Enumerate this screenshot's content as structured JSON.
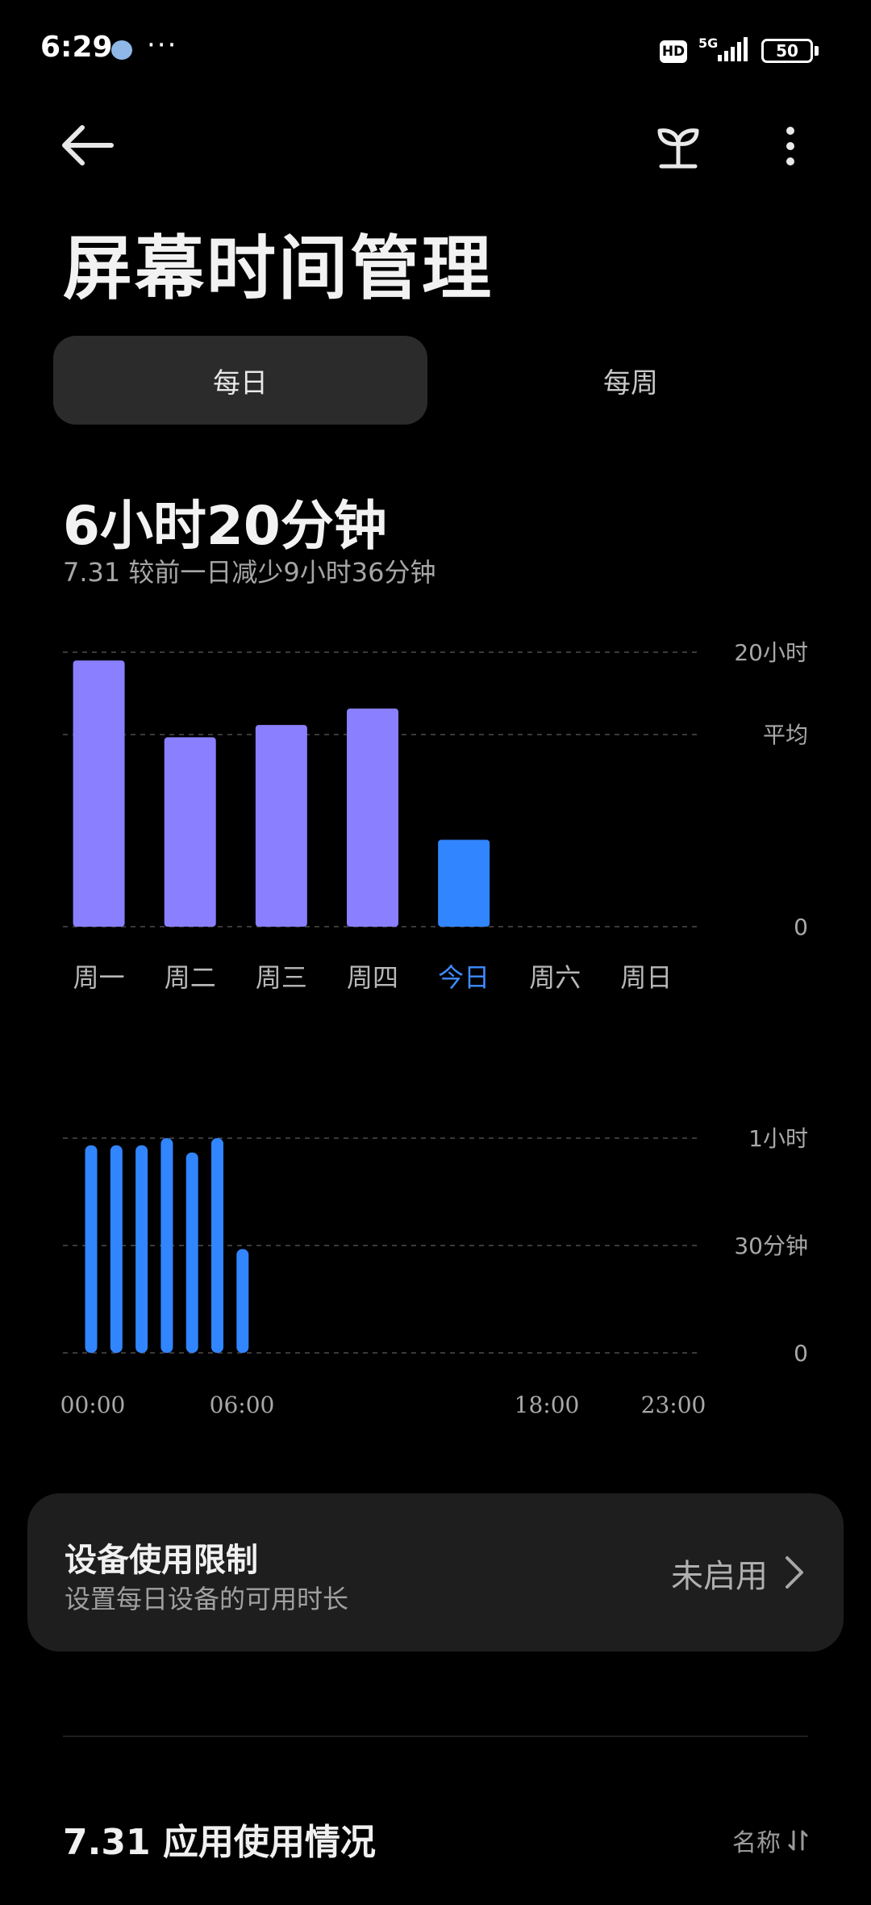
{
  "status_bar": {
    "time": "6:29",
    "more": "···",
    "hd": "HD",
    "network": "5G",
    "battery": "50"
  },
  "header": {
    "title": "屏幕时间管理",
    "icons": {
      "back": "back-arrow-icon",
      "sprout": "sprout-icon",
      "more": "more-vertical-icon"
    }
  },
  "segment": {
    "daily": "每日",
    "weekly": "每周",
    "selected": "daily"
  },
  "summary": {
    "total": "6小时20分钟",
    "compare": "7.31 较前一日减少9小时36分钟"
  },
  "colors": {
    "weekly_bar": "#8a7fff",
    "today_bar": "#3185ff",
    "hourly_bar": "#3185ff",
    "today_label": "#3f8cff"
  },
  "chart_data": [
    {
      "type": "bar",
      "categories": [
        "周一",
        "周二",
        "周三",
        "周四",
        "今日",
        "周六",
        "周日"
      ],
      "values": [
        19.4,
        13.8,
        14.7,
        15.9,
        6.33,
        null,
        null
      ],
      "highlight_index": 4,
      "ylim": [
        0,
        20
      ],
      "y_tick_labels": [
        {
          "value": 20,
          "label": "20小时"
        },
        {
          "value": 14,
          "label": "平均"
        },
        {
          "value": 0,
          "label": "0"
        }
      ],
      "grid": true
    },
    {
      "type": "bar",
      "x_unit": "hour",
      "x": [
        0,
        1,
        2,
        3,
        4,
        5,
        6
      ],
      "values": [
        58,
        58,
        58,
        60,
        56,
        60,
        29
      ],
      "ylim": [
        0,
        60
      ],
      "y_tick_labels": [
        {
          "value": 60,
          "label": "1小时"
        },
        {
          "value": 30,
          "label": "30分钟"
        },
        {
          "value": 0,
          "label": "0"
        }
      ],
      "x_tick_labels": [
        {
          "value": 0,
          "label": "00:00"
        },
        {
          "value": 6,
          "label": "06:00"
        },
        {
          "value": 18,
          "label": "18:00"
        },
        {
          "value": 23,
          "label": "23:00"
        }
      ],
      "grid": true
    }
  ],
  "device_limit": {
    "title": "设备使用限制",
    "subtitle": "设置每日设备的可用时长",
    "status": "未启用",
    "chevron": "chevron-right-icon"
  },
  "app_usage": {
    "title": "7.31 应用使用情况",
    "sort_label": "名称",
    "sort_icon": "sort-icon"
  }
}
